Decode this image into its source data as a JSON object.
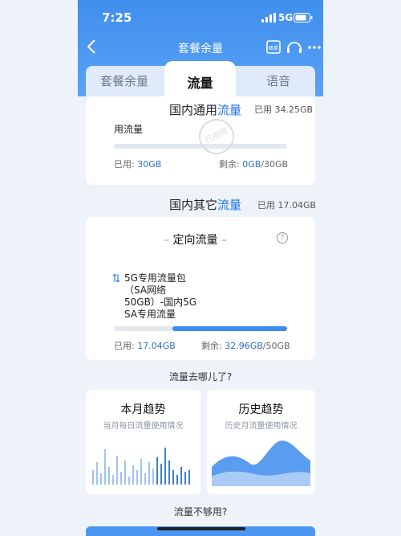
{
  "status_bar": {
    "time": "7:25",
    "network": "5G"
  },
  "nav": {
    "title": "套餐余量",
    "icons": [
      "back-icon",
      "bill-icon",
      "headset-icon",
      "more-icon"
    ],
    "bill_icon_text": "賬单"
  },
  "tabs": [
    {
      "label": "套餐余量",
      "active": false
    },
    {
      "label": "流量",
      "active": true
    },
    {
      "label": "语音",
      "active": false
    }
  ],
  "domestic_general": {
    "title_prefix": "国内通用",
    "title_highlight": "流量",
    "used_label": "已用 34.25GB",
    "item_label": "用流量",
    "progress_pct": 100,
    "used_text": "已用:",
    "used_value": "30GB",
    "remain_text": "剩余:",
    "remain_value": "0GB",
    "total": "/30GB",
    "stamp_text": "已用完"
  },
  "domestic_other": {
    "title_prefix": "国内其它",
    "title_highlight": "流量",
    "used_label": "已用 17.04GB"
  },
  "targeted": {
    "title": "定向流量",
    "help_icon": "?",
    "package_lines": [
      "5G专用流量包",
      "（SA网络",
      "50GB）-国内5G",
      "SA专用流量"
    ],
    "progress_pct": 34,
    "used_text": "已用:",
    "used_value": "17.04GB",
    "remain_text": "剩余:",
    "remain_value": "32.96GB",
    "total": "/50GB"
  },
  "where_title": "流量去哪儿了?",
  "trends": [
    {
      "title": "本月趋势",
      "subtitle": "当月每日流量使用情况"
    },
    {
      "title": "历史趋势",
      "subtitle": "历史月流量使用情况"
    }
  ],
  "not_enough_title": "流量不够用?",
  "colors": {
    "accent": "#1e74e8",
    "header": "#4a96f0"
  }
}
